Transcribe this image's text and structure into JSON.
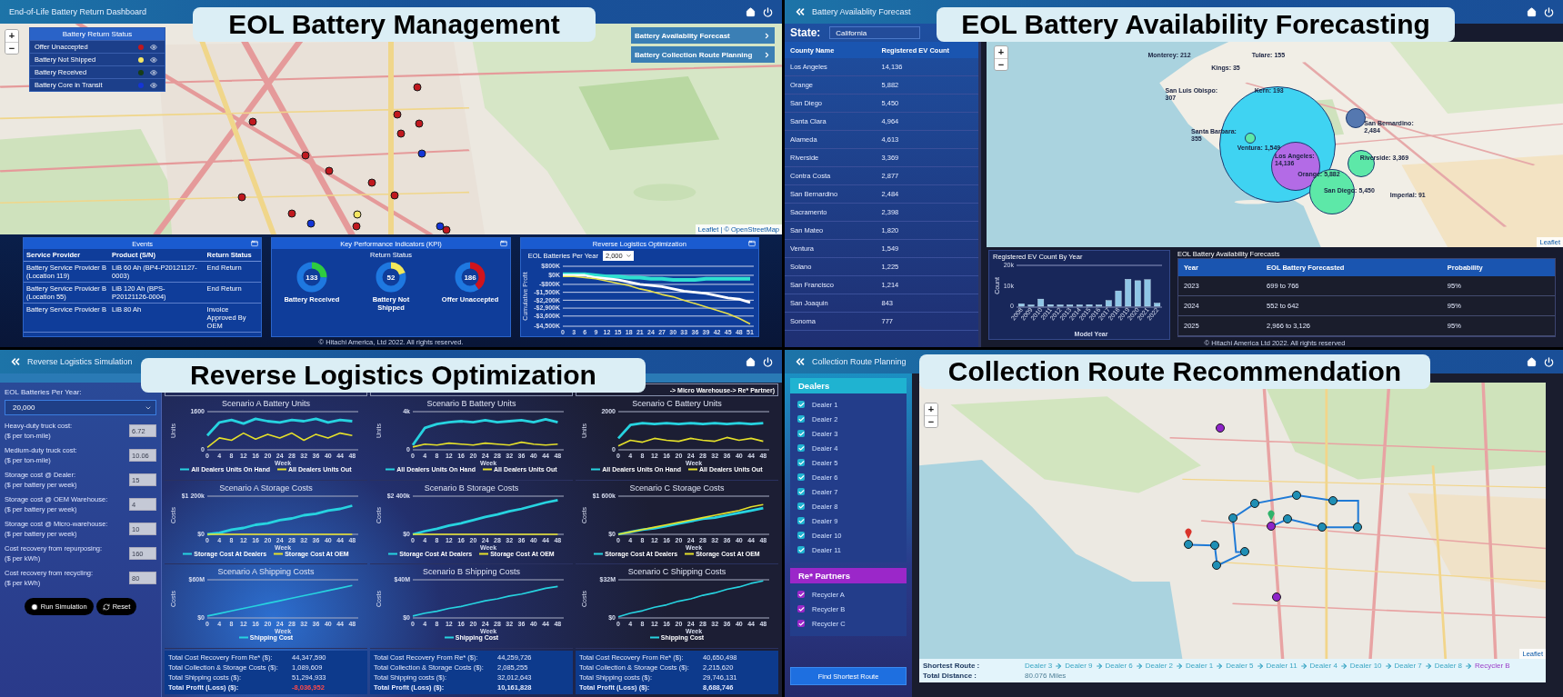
{
  "management": {
    "header_title": "End-of-Life Battery Return Dashboard",
    "caption": "EOL Battery Management",
    "zoom_buttons": [
      "+",
      "−"
    ],
    "legend": {
      "title": "Battery Return Status",
      "items": [
        {
          "label": "Offer Unaccepted",
          "color": "#c0181e"
        },
        {
          "label": "Battery Not Shipped",
          "color": "#f5e663"
        },
        {
          "label": "Battery Received",
          "color": "#173d17"
        },
        {
          "label": "Battery Core in Transit",
          "color": "#1435d6"
        }
      ]
    },
    "nav_buttons": [
      "Battery Availablity Forecast",
      "Battery Collection Route Planning"
    ],
    "map_markers": [
      {
        "color": "#c0181e"
      },
      {
        "color": "#c0181e"
      },
      {
        "color": "#c0181e"
      },
      {
        "color": "#c0181e"
      },
      {
        "color": "#c0181e"
      },
      {
        "color": "#c0181e"
      },
      {
        "color": "#1435d6"
      },
      {
        "color": "#c0181e"
      },
      {
        "color": "#c0181e"
      },
      {
        "color": "#c0181e"
      },
      {
        "color": "#c0181e"
      },
      {
        "color": "#c0181e"
      },
      {
        "color": "#1435d6"
      },
      {
        "color": "#f5e663"
      },
      {
        "color": "#c0181e"
      },
      {
        "color": "#1435d6"
      },
      {
        "color": "#c0181e"
      }
    ],
    "attribution": "Leaflet | © OpenStreetMap",
    "events": {
      "title": "Events",
      "columns": [
        "Service Provider",
        "Product (S/N)",
        "Return Status"
      ],
      "rows": [
        [
          "Battery Service Provider B (Location 119)",
          "LiB 60 Ah (BP4-P20121127-0003)",
          "End Return"
        ],
        [
          "Battery Service Provider B (Location 55)",
          "LiB 120 Ah (BPS-P20121126-0004)",
          "End Return"
        ],
        [
          "Battery Service Provider B",
          "LiB 80 Ah",
          "Invoice Approved By OEM"
        ]
      ]
    },
    "kpi": {
      "title": "Key Performance Indicators (KPI)",
      "subtitle": "Return Status",
      "gauges": [
        {
          "value": "133",
          "label": "Battery Received",
          "color": "#2ecc40",
          "level": 0.25
        },
        {
          "value": "52",
          "label": "Battery Not Shipped",
          "color": "#f2e85a",
          "level": 0.2
        },
        {
          "value": "186",
          "label": "Offer Unaccepted",
          "color": "#d0141c",
          "level": 0.4
        }
      ]
    },
    "optimization": {
      "title": "Reverse Logistics Optimization",
      "select_label": "EOL Batteries Per Year",
      "select_value": "2,000",
      "chart_data": {
        "type": "line",
        "grid": true,
        "ylabel": "Cumulative Profit",
        "x": [
          0,
          3,
          6,
          9,
          12,
          15,
          18,
          21,
          24,
          27,
          30,
          33,
          36,
          39,
          42,
          45,
          48,
          51
        ],
        "xlim": [
          0,
          52
        ],
        "ylim": [
          -4500,
          800
        ],
        "xticks": [
          0,
          3,
          6,
          9,
          12,
          15,
          18,
          21,
          24,
          27,
          30,
          33,
          36,
          39,
          42,
          45,
          48,
          51
        ],
        "yticks": [
          {
            "value": 800,
            "label": "$800K"
          },
          {
            "value": 0,
            "label": "$0K"
          },
          {
            "value": -800,
            "label": "-$800K"
          },
          {
            "value": -1500,
            "label": "-$1,500K"
          },
          {
            "value": -2200,
            "label": "-$2,200K"
          },
          {
            "value": -2900,
            "label": "-$2,900K"
          },
          {
            "value": -3600,
            "label": "-$3,600K"
          },
          {
            "value": -4500,
            "label": "-$4,500K"
          }
        ],
        "series": [
          {
            "color": "#2de0d0",
            "values": [
              100,
              100,
              100,
              0,
              -100,
              -100,
              -200,
              -200,
              -300,
              -300,
              -400,
              -400,
              -400,
              -300,
              -300,
              -300,
              -300,
              -300
            ]
          },
          {
            "color": "#ffffff",
            "values": [
              0,
              0,
              0,
              -200,
              -300,
              -400,
              -600,
              -800,
              -900,
              -1000,
              -1200,
              -1400,
              -1500,
              -1600,
              -1800,
              -2000,
              -2100,
              -2400
            ]
          },
          {
            "color": "#e8e04a",
            "values": [
              -100,
              -100,
              -200,
              -300,
              -500,
              -700,
              -900,
              -1200,
              -1400,
              -1700,
              -1900,
              -2200,
              -2500,
              -2800,
              -3100,
              -3400,
              -3800,
              -4300
            ]
          }
        ]
      }
    },
    "footer": "© Hitachi America, Ltd 2022. All rights reserved."
  },
  "forecasting": {
    "header_title": "Battery Availablity Forecast",
    "caption": "EOL Battery Availability Forecasting",
    "state_label": "State:",
    "state_value": "California",
    "counties": {
      "columns": [
        "County Name",
        "Registered EV Count"
      ],
      "rows": [
        [
          "Los Angeles",
          "14,136"
        ],
        [
          "Orange",
          "5,882"
        ],
        [
          "San Diego",
          "5,450"
        ],
        [
          "Santa Clara",
          "4,964"
        ],
        [
          "Alameda",
          "4,613"
        ],
        [
          "Riverside",
          "3,369"
        ],
        [
          "Contra Costa",
          "2,877"
        ],
        [
          "San Bernardino",
          "2,484"
        ],
        [
          "Sacramento",
          "2,398"
        ],
        [
          "San Mateo",
          "1,820"
        ],
        [
          "Ventura",
          "1,549"
        ],
        [
          "Solano",
          "1,225"
        ],
        [
          "San Francisco",
          "1,214"
        ],
        [
          "San Joaquin",
          "843"
        ],
        [
          "Sonoma",
          "777"
        ]
      ]
    },
    "zoom_buttons": [
      "+",
      "−"
    ],
    "bubbles": [
      {
        "color": "#3fd3f2"
      },
      {
        "color": "#b36be6"
      },
      {
        "color": "#5de8a8"
      },
      {
        "color": "#5de8a8"
      },
      {
        "color": "#5578b0"
      },
      {
        "color": "#5de8a8"
      }
    ],
    "map_labels": [
      "Monterey: 212",
      "Kings: 35",
      "Tulare: 155",
      "San Luis Obispo: 307",
      "Kern: 193",
      "Santa Barbara: 355",
      "Ventura: 1,549",
      "Los Angeles: 14,136",
      "Orange: 5,882",
      "San Bernardino: 2,484",
      "Riverside: 3,369",
      "San Diego: 5,450",
      "Imperial: 91"
    ],
    "attribution": "Leaflet",
    "ev_chart": {
      "title": "Registered EV Count By Year",
      "chart_data": {
        "type": "bar",
        "xlabel": "Model Year",
        "ylabel": "Count",
        "categories": [
          "2008",
          "2009",
          "2010",
          "2011",
          "2012",
          "2013",
          "2014",
          "2015",
          "2016",
          "2017",
          "2018",
          "2019",
          "2020",
          "2021",
          "2022"
        ],
        "values": [
          1200,
          300,
          3500,
          800,
          500,
          500,
          500,
          800,
          200,
          2800,
          7500,
          13200,
          12500,
          13000,
          1500
        ],
        "ylim": [
          0,
          20000
        ],
        "yticks": [
          {
            "value": 0,
            "label": "0"
          },
          {
            "value": 10000,
            "label": "10k"
          },
          {
            "value": 20000,
            "label": "20k"
          }
        ]
      }
    },
    "forecasts": {
      "title": "EOL Battery Availability Forecasts",
      "columns": [
        "Year",
        "EOL Battery Forecasted",
        "Probability"
      ],
      "rows": [
        [
          "2023",
          "699 to 766",
          "95%"
        ],
        [
          "2024",
          "552 to 642",
          "95%"
        ],
        [
          "2025",
          "2,966 to 3,126",
          "95%"
        ]
      ]
    },
    "footer": "© Hitachi America Ltd 2022. All rights reserved"
  },
  "simulation": {
    "header_title": "Reverse Logistics Simulation",
    "caption": "Reverse Logistics Optimization",
    "batteries_label": "EOL Batteries Per Year:",
    "batteries_value": "20,000",
    "fields": [
      {
        "label": "Heavy-duty truck cost:",
        "unit": "($ per ton-mile)",
        "value": "6.72"
      },
      {
        "label": "Medium-duty truck cost:",
        "unit": "($ per ton-mile)",
        "value": "10.06"
      },
      {
        "label": "Storage cost @ Dealer:",
        "unit": "($ per battery per week)",
        "value": "15"
      },
      {
        "label": "Storage cost @ OEM Warehouse:",
        "unit": "($ per battery per week)",
        "value": "4"
      },
      {
        "label": "Storage cost @ Micro-warehouse:",
        "unit": "($ per battery per week)",
        "value": "10"
      },
      {
        "label": "Cost recovery from repurposing:",
        "unit": "($ per kWh)",
        "value": "160"
      },
      {
        "label": "Cost recovery from recycling:",
        "unit": "($ per kWh)",
        "value": "80"
      }
    ],
    "buttons": [
      {
        "label": "Run Simulation",
        "kind": "run"
      },
      {
        "label": "Reset",
        "kind": "reset"
      }
    ],
    "scenarios": [
      {
        "charts": [
          {
            "title": "Scenario A Battery Units",
            "chart_data": {
              "type": "line",
              "xlabel": "Week",
              "ylabel": "Units",
              "x": [
                0,
                4,
                8,
                12,
                16,
                20,
                24,
                28,
                32,
                36,
                40,
                44,
                48
              ],
              "xlim": [
                0,
                50
              ],
              "ylim": [
                0,
                1600
              ],
              "xticks": [
                0,
                4,
                8,
                12,
                16,
                20,
                24,
                28,
                32,
                36,
                40,
                44,
                48
              ],
              "yticks": [
                0,
                1600
              ],
              "series": [
                {
                  "name": "All Dealers Units On Hand",
                  "color": "#27d3e0",
                  "values": [
                    600,
                    1150,
                    1250,
                    1100,
                    1300,
                    1200,
                    1150,
                    1250,
                    1200,
                    1300,
                    1150,
                    1250,
                    1200
                  ]
                },
                {
                  "name": "All Dealers Units Out",
                  "color": "#e5e02a",
                  "values": [
                    100,
                    500,
                    400,
                    700,
                    450,
                    650,
                    500,
                    700,
                    400,
                    650,
                    500,
                    700,
                    600
                  ]
                }
              ]
            }
          },
          {
            "title": "Scenario A Storage Costs",
            "chart_data": {
              "type": "line",
              "xlabel": "Week",
              "ylabel": "Costs",
              "x": [
                0,
                4,
                8,
                12,
                16,
                20,
                24,
                28,
                32,
                36,
                40,
                44,
                48
              ],
              "xlim": [
                0,
                50
              ],
              "ylim": [
                0,
                1200
              ],
              "xticks": [
                0,
                4,
                8,
                12,
                16,
                20,
                24,
                28,
                32,
                36,
                40,
                44,
                48
              ],
              "yticks": [
                {
                  "value": 0,
                  "label": "$0"
                },
                {
                  "value": 1200,
                  "label": "$1 200k"
                }
              ],
              "series": [
                {
                  "name": "Storage Cost At Dealers",
                  "color": "#27d3e0",
                  "values": [
                    0,
                    50,
                    150,
                    200,
                    300,
                    350,
                    450,
                    500,
                    600,
                    650,
                    750,
                    800,
                    900
                  ]
                },
                {
                  "name": "Storage Cost At OEM",
                  "color": "#e5e02a",
                  "values": [
                    0,
                    0,
                    0,
                    0,
                    0,
                    0,
                    0,
                    0,
                    0,
                    0,
                    0,
                    0,
                    0
                  ]
                }
              ]
            }
          },
          {
            "title": "Scenario A Shipping Costs",
            "chart_data": {
              "type": "line",
              "xlabel": "Week",
              "ylabel": "Costs",
              "x": [
                0,
                4,
                8,
                12,
                16,
                20,
                24,
                28,
                32,
                36,
                40,
                44,
                48
              ],
              "xlim": [
                0,
                50
              ],
              "ylim": [
                0,
                60
              ],
              "xticks": [
                0,
                4,
                8,
                12,
                16,
                20,
                24,
                28,
                32,
                36,
                40,
                44,
                48
              ],
              "yticks": [
                {
                  "value": 0,
                  "label": "$0"
                },
                {
                  "value": 60,
                  "label": "$60M"
                }
              ],
              "series": [
                {
                  "name": "Shipping Cost",
                  "color": "#27d3e0",
                  "values": [
                    3,
                    7,
                    11,
                    15,
                    19,
                    23,
                    27,
                    31,
                    35,
                    39,
                    43,
                    47,
                    51
                  ]
                }
              ]
            }
          }
        ],
        "totals": [
          {
            "label": "Total Cost Recovery From Re* ($):",
            "value": "44,347,590",
            "kind": "line",
            "negative": false
          },
          {
            "label": "Total Collection & Storage Costs ($):",
            "value": "1,089,609",
            "kind": "line",
            "negative": false
          },
          {
            "label": "Total Shipping costs ($):",
            "value": "51,294,933",
            "kind": "line",
            "negative": false
          },
          {
            "label": "Total Profit (Loss) ($):",
            "value": "-8,036,952",
            "kind": "total",
            "negative": true
          }
        ]
      },
      {
        "charts": [
          {
            "title": "Scenario B Battery Units",
            "chart_data": {
              "type": "line",
              "xlabel": "Week",
              "ylabel": "Units",
              "x": [
                0,
                4,
                8,
                12,
                16,
                20,
                24,
                28,
                32,
                36,
                40,
                44,
                48
              ],
              "xlim": [
                0,
                50
              ],
              "ylim": [
                0,
                4000
              ],
              "xticks": [
                0,
                4,
                8,
                12,
                16,
                20,
                24,
                28,
                32,
                36,
                40,
                44,
                48
              ],
              "yticks": [
                0,
                {
                  "value": 4000,
                  "label": "4k"
                }
              ],
              "series": [
                {
                  "name": "All Dealers Units On Hand",
                  "color": "#27d3e0",
                  "values": [
                    500,
                    2300,
                    2700,
                    2900,
                    3000,
                    2900,
                    3100,
                    2900,
                    3000,
                    3100,
                    2900,
                    3200,
                    2900
                  ]
                },
                {
                  "name": "All Dealers Units Out",
                  "color": "#e5e02a",
                  "values": [
                    300,
                    600,
                    500,
                    700,
                    600,
                    500,
                    700,
                    600,
                    500,
                    800,
                    600,
                    500,
                    600
                  ]
                }
              ]
            }
          },
          {
            "title": "Scenario B Storage Costs",
            "chart_data": {
              "type": "line",
              "xlabel": "Week",
              "ylabel": "Costs",
              "x": [
                0,
                4,
                8,
                12,
                16,
                20,
                24,
                28,
                32,
                36,
                40,
                44,
                48
              ],
              "xlim": [
                0,
                50
              ],
              "ylim": [
                0,
                2400
              ],
              "xticks": [
                0,
                4,
                8,
                12,
                16,
                20,
                24,
                28,
                32,
                36,
                40,
                44,
                48
              ],
              "yticks": [
                {
                  "value": 0,
                  "label": "$0"
                },
                {
                  "value": 2400,
                  "label": "$2 400k"
                }
              ],
              "series": [
                {
                  "name": "Storage Cost At Dealers",
                  "color": "#27d3e0",
                  "values": [
                    0,
                    200,
                    350,
                    550,
                    700,
                    900,
                    1100,
                    1250,
                    1450,
                    1600,
                    1800,
                    2000,
                    2150
                  ]
                },
                {
                  "name": "Storage Cost At OEM",
                  "color": "#e5e02a",
                  "values": [
                    0,
                    0,
                    0,
                    0,
                    0,
                    0,
                    0,
                    0,
                    0,
                    0,
                    0,
                    0,
                    0
                  ]
                }
              ]
            }
          },
          {
            "title": "Scenario B Shipping Costs",
            "chart_data": {
              "type": "line",
              "xlabel": "Week",
              "ylabel": "Costs",
              "x": [
                0,
                4,
                8,
                12,
                16,
                20,
                24,
                28,
                32,
                36,
                40,
                44,
                48
              ],
              "xlim": [
                0,
                50
              ],
              "ylim": [
                0,
                40
              ],
              "xticks": [
                0,
                4,
                8,
                12,
                16,
                20,
                24,
                28,
                32,
                36,
                40,
                44,
                48
              ],
              "yticks": [
                {
                  "value": 0,
                  "label": "$0"
                },
                {
                  "value": 40,
                  "label": "$40M"
                }
              ],
              "series": [
                {
                  "name": "Shipping Cost",
                  "color": "#27d3e0",
                  "values": [
                    2,
                    5,
                    7,
                    10,
                    12,
                    15,
                    18,
                    20,
                    23,
                    25,
                    28,
                    31,
                    33
                  ]
                }
              ]
            }
          }
        ],
        "totals": [
          {
            "label": "Total Cost Recovery From Re* ($):",
            "value": "44,259,726",
            "kind": "line",
            "negative": false
          },
          {
            "label": "Total Collection & Storage Costs ($):",
            "value": "2,085,255",
            "kind": "line",
            "negative": false
          },
          {
            "label": "Total Shipping costs ($):",
            "value": "32,012,643",
            "kind": "line",
            "negative": false
          },
          {
            "label": "Total Profit (Loss) ($):",
            "value": "10,161,828",
            "kind": "total",
            "negative": false
          }
        ]
      },
      {
        "heading": "-> Micro Warehouse-> Re* Partner)",
        "charts": [
          {
            "title": "Scenario C Battery Units",
            "chart_data": {
              "type": "line",
              "xlabel": "Week",
              "ylabel": "Units",
              "x": [
                0,
                4,
                8,
                12,
                16,
                20,
                24,
                28,
                32,
                36,
                40,
                44,
                48
              ],
              "xlim": [
                0,
                50
              ],
              "ylim": [
                0,
                2000
              ],
              "xticks": [
                0,
                4,
                8,
                12,
                16,
                20,
                24,
                28,
                32,
                36,
                40,
                44,
                48
              ],
              "yticks": [
                0,
                2000
              ],
              "series": [
                {
                  "name": "All Dealers Units On Hand",
                  "color": "#27d3e0",
                  "values": [
                    600,
                    1300,
                    1400,
                    1350,
                    1400,
                    1350,
                    1400,
                    1350,
                    1400,
                    1350,
                    1400,
                    1350,
                    1400
                  ]
                },
                {
                  "name": "All Dealers Units Out",
                  "color": "#e5e02a",
                  "values": [
                    200,
                    500,
                    400,
                    600,
                    500,
                    450,
                    600,
                    500,
                    450,
                    650,
                    500,
                    600,
                    450
                  ]
                }
              ]
            }
          },
          {
            "title": "Scenario C Storage Costs",
            "chart_data": {
              "type": "line",
              "xlabel": "Week",
              "ylabel": "Costs",
              "x": [
                0,
                4,
                8,
                12,
                16,
                20,
                24,
                28,
                32,
                36,
                40,
                44,
                48
              ],
              "xlim": [
                0,
                50
              ],
              "ylim": [
                0,
                1600
              ],
              "xticks": [
                0,
                4,
                8,
                12,
                16,
                20,
                24,
                28,
                32,
                36,
                40,
                44,
                48
              ],
              "yticks": [
                {
                  "value": 0,
                  "label": "$0"
                },
                {
                  "value": 1600,
                  "label": "$1 600k"
                }
              ],
              "series": [
                {
                  "name": "Storage Cost At Dealers",
                  "color": "#27d3e0",
                  "values": [
                    0,
                    100,
                    200,
                    250,
                    350,
                    450,
                    550,
                    650,
                    700,
                    800,
                    900,
                    1000,
                    1100
                  ]
                },
                {
                  "name": "Storage Cost At OEM",
                  "color": "#e5e02a",
                  "values": [
                    0,
                    100,
                    200,
                    300,
                    400,
                    500,
                    600,
                    700,
                    800,
                    900,
                    1000,
                    1150,
                    1250
                  ]
                }
              ]
            }
          },
          {
            "title": "Scenario C Shipping Costs",
            "chart_data": {
              "type": "line",
              "xlabel": "Week",
              "ylabel": "Costs",
              "x": [
                0,
                4,
                8,
                12,
                16,
                20,
                24,
                28,
                32,
                36,
                40,
                44,
                48
              ],
              "xlim": [
                0,
                50
              ],
              "ylim": [
                0,
                32
              ],
              "xticks": [
                0,
                4,
                8,
                12,
                16,
                20,
                24,
                28,
                32,
                36,
                40,
                44,
                48
              ],
              "yticks": [
                {
                  "value": 0,
                  "label": "$0"
                },
                {
                  "value": 32,
                  "label": "$32M"
                }
              ],
              "series": [
                {
                  "name": "Shipping Cost",
                  "color": "#27d3e0",
                  "values": [
                    1,
                    4,
                    6,
                    9,
                    11,
                    14,
                    16,
                    19,
                    21,
                    24,
                    26,
                    29,
                    31
                  ]
                }
              ]
            }
          }
        ],
        "totals": [
          {
            "label": "Total Cost Recovery From Re* ($):",
            "value": "40,650,498",
            "kind": "line",
            "negative": false
          },
          {
            "label": "Total Collection & Storage Costs ($):",
            "value": "2,215,620",
            "kind": "line",
            "negative": false
          },
          {
            "label": "Total Shipping costs ($):",
            "value": "29,746,131",
            "kind": "line",
            "negative": false
          },
          {
            "label": "Total Profit (Loss) ($):",
            "value": "8,688,746",
            "kind": "total",
            "negative": false
          }
        ]
      }
    ]
  },
  "route_planning": {
    "header_title": "Collection Route Planning",
    "caption": "Collection Route Recommendation",
    "dealers": {
      "title": "Dealers",
      "items": [
        {
          "label": "Dealer 1",
          "checked": true
        },
        {
          "label": "Dealer 2",
          "checked": true
        },
        {
          "label": "Dealer 3",
          "checked": true
        },
        {
          "label": "Dealer 4",
          "checked": true
        },
        {
          "label": "Dealer 5",
          "checked": true
        },
        {
          "label": "Dealer 6",
          "checked": true
        },
        {
          "label": "Dealer 7",
          "checked": true
        },
        {
          "label": "Dealer 8",
          "checked": true
        },
        {
          "label": "Dealer 9",
          "checked": true
        },
        {
          "label": "Dealer 10",
          "checked": true
        },
        {
          "label": "Dealer 11",
          "checked": true
        }
      ]
    },
    "partners": {
      "title": "Re* Partners",
      "items": [
        {
          "label": "Recycler A",
          "checked": true
        },
        {
          "label": "Recycler B",
          "checked": true
        },
        {
          "label": "Recycler C",
          "checked": true
        }
      ]
    },
    "button": "Find Shortest Route",
    "zoom_buttons": [
      "+",
      "−"
    ],
    "map_markers": [
      {
        "color": "#1f8fb5"
      },
      {
        "color": "#1f8fb5"
      },
      {
        "color": "#1f8fb5"
      },
      {
        "color": "#1f8fb5"
      },
      {
        "color": "#1f8fb5"
      },
      {
        "color": "#1f8fb5"
      },
      {
        "color": "#1f8fb5"
      },
      {
        "color": "#1f8fb5"
      },
      {
        "color": "#1f8fb5"
      },
      {
        "color": "#1f8fb5"
      },
      {
        "color": "#1f8fb5"
      },
      {
        "color": "#8e24c8"
      },
      {
        "color": "#8e24c8"
      },
      {
        "color": "#8e24c8"
      }
    ],
    "attribution": "Leaflet",
    "route_label": "Shortest Route :",
    "route": [
      {
        "text": "Dealer 3",
        "kind": "dealer"
      },
      {
        "text": "Dealer 9",
        "kind": "dealer"
      },
      {
        "text": "Dealer 6",
        "kind": "dealer"
      },
      {
        "text": "Dealer 2",
        "kind": "dealer"
      },
      {
        "text": "Dealer 1",
        "kind": "dealer"
      },
      {
        "text": "Dealer 5",
        "kind": "dealer"
      },
      {
        "text": "Dealer 11",
        "kind": "dealer"
      },
      {
        "text": "Dealer 4",
        "kind": "dealer"
      },
      {
        "text": "Dealer 10",
        "kind": "dealer"
      },
      {
        "text": "Dealer 7",
        "kind": "dealer"
      },
      {
        "text": "Dealer 8",
        "kind": "dealer"
      },
      {
        "text": "Recycler B",
        "kind": "recycler"
      }
    ],
    "distance_label": "Total Distance :",
    "distance": "80.076 Miles"
  }
}
